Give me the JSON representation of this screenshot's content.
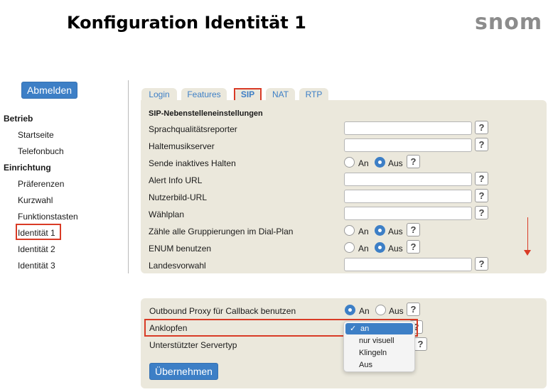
{
  "header": {
    "title": "Konfiguration Identität 1",
    "logo_text": "snom"
  },
  "sidebar": {
    "logout_label": "Abmelden",
    "sections": [
      {
        "label": "Betrieb",
        "items": [
          "Startseite",
          "Telefonbuch"
        ]
      },
      {
        "label": "Einrichtung",
        "items": [
          "Präferenzen",
          "Kurzwahl",
          "Funktionstasten",
          "Identität 1",
          "Identität 2",
          "Identität 3"
        ]
      }
    ],
    "active_item": "Identität 1"
  },
  "tabs": [
    {
      "label": "Login",
      "active": false
    },
    {
      "label": "Features",
      "active": false
    },
    {
      "label": "SIP",
      "active": true
    },
    {
      "label": "NAT",
      "active": false
    },
    {
      "label": "RTP",
      "active": false
    }
  ],
  "sip_settings": {
    "heading": "SIP-Nebenstelleneinstellungen",
    "help_glyph": "?",
    "radio_on": "An",
    "radio_off": "Aus",
    "rows": [
      {
        "label": "Sprachqualitätsreporter",
        "type": "text",
        "value": ""
      },
      {
        "label": "Haltemusikserver",
        "type": "text",
        "value": ""
      },
      {
        "label": "Sende inaktives Halten",
        "type": "radio",
        "value": "Aus"
      },
      {
        "label": "Alert Info URL",
        "type": "text",
        "value": ""
      },
      {
        "label": "Nutzerbild-URL",
        "type": "text",
        "value": ""
      },
      {
        "label": "Wählplan",
        "type": "text",
        "value": ""
      },
      {
        "label": "Zähle alle Gruppierungen im Dial-Plan",
        "type": "radio",
        "value": "Aus"
      },
      {
        "label": "ENUM benutzen",
        "type": "radio",
        "value": "Aus"
      },
      {
        "label": "Landesvorwahl",
        "type": "text",
        "value": ""
      }
    ]
  },
  "bottom_settings": {
    "rows": [
      {
        "label": "Outbound Proxy für Callback benutzen",
        "type": "radio",
        "value": "An"
      },
      {
        "label": "Anklopfen",
        "type": "select",
        "value": "an"
      },
      {
        "label": "Unterstützter Servertyp",
        "type": "select",
        "value": ""
      }
    ],
    "anklopfen_options": [
      "an",
      "nur visuell",
      "Klingeln",
      "Aus"
    ],
    "anklopfen_selected": "an",
    "check_glyph": "✓",
    "apply_label": "Übernehmen"
  },
  "colors": {
    "accent": "#3d7fc6",
    "panel": "#ebe8dc",
    "highlight": "#d93b26",
    "logo": "#8c8c8c"
  }
}
